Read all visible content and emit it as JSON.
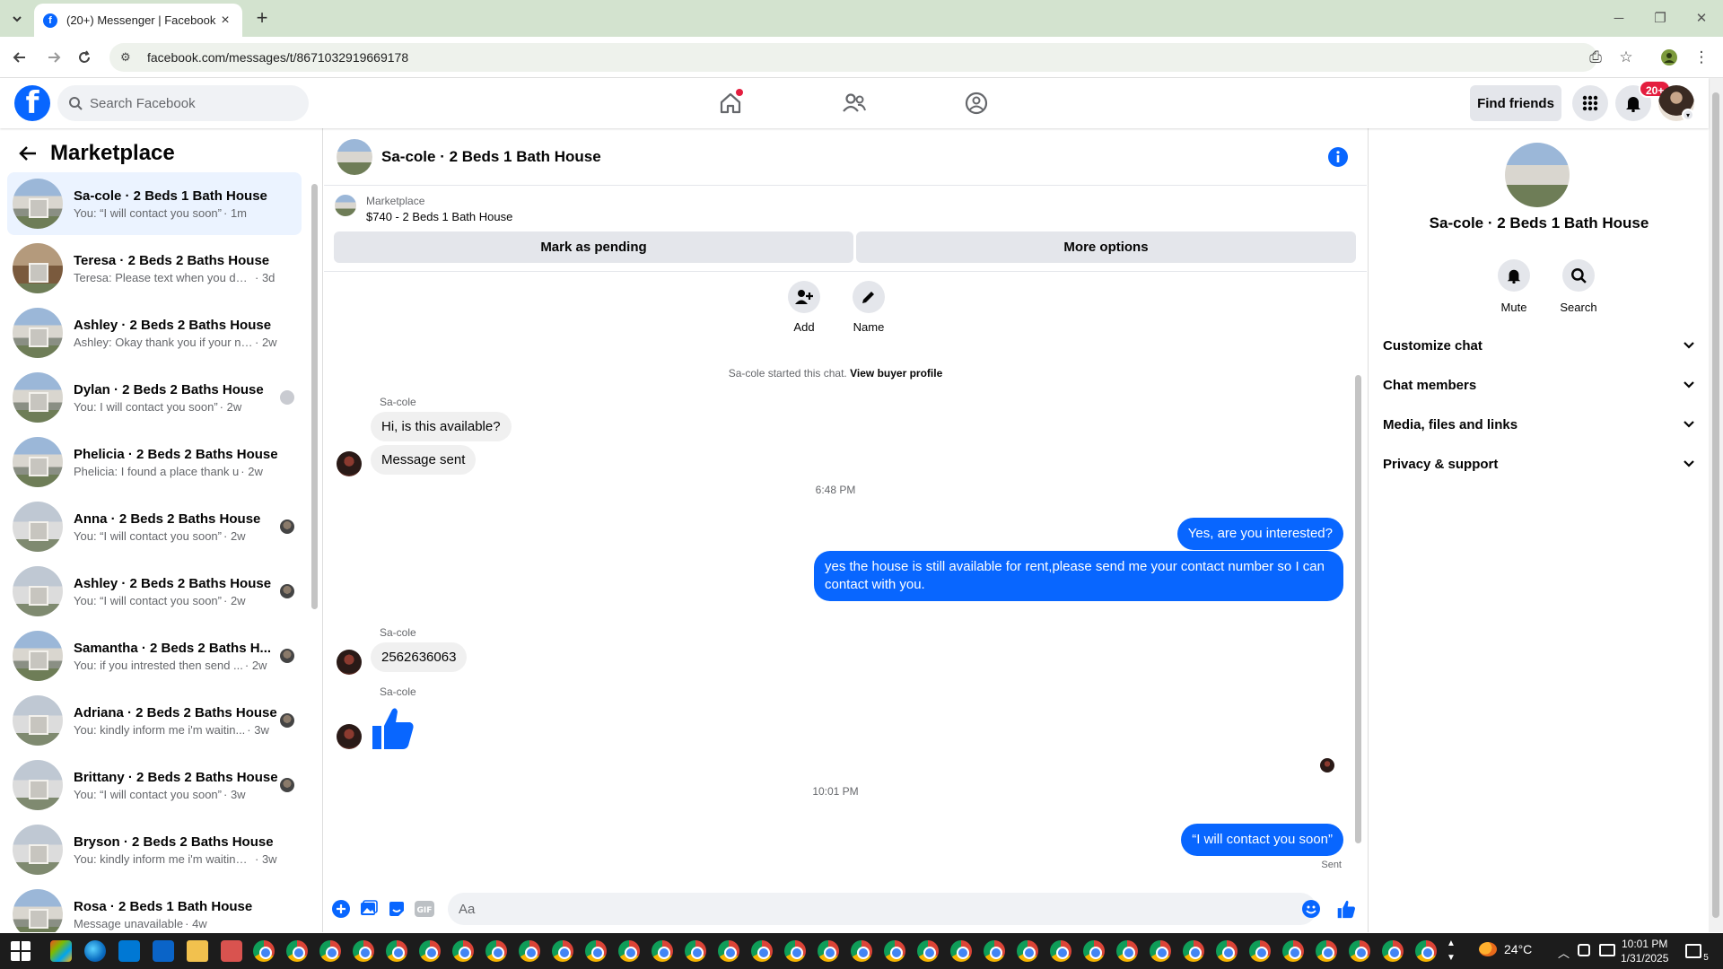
{
  "browser": {
    "tab_title": "(20+) Messenger | Facebook",
    "url": "facebook.com/messages/t/8671032919669178"
  },
  "fb_header": {
    "search_placeholder": "Search Facebook",
    "find_friends_label": "Find friends",
    "notification_count": "20+"
  },
  "sidebar": {
    "title": "Marketplace",
    "conversations": [
      {
        "name": "Sa-cole · 2 Beds 1 Bath House",
        "preview": "You: “I will contact you soon”",
        "time": "· 1m",
        "active": true
      },
      {
        "name": "Teresa · 2 Beds 2 Baths House",
        "preview": "Teresa: Please text when you do. T...",
        "time": "· 3d"
      },
      {
        "name": "Ashley · 2 Beds 2 Baths House",
        "preview": "Ashley: Okay thank you if your not...",
        "time": "· 2w"
      },
      {
        "name": "Dylan · 2 Beds 2 Baths House",
        "preview": "You: I will contact you soon”",
        "time": "· 2w"
      },
      {
        "name": "Phelicia · 2 Beds 2 Baths House",
        "preview": "Phelicia: I found a place thank u",
        "time": "· 2w"
      },
      {
        "name": "Anna · 2 Beds 2 Baths House",
        "preview": "You: “I will contact you soon”",
        "time": "· 2w"
      },
      {
        "name": "Ashley · 2 Beds 2 Baths House",
        "preview": "You: “I will contact you soon”",
        "time": "· 2w"
      },
      {
        "name": "Samantha · 2 Beds 2 Baths H...",
        "preview": "You: if you intrested then send ...",
        "time": "· 2w"
      },
      {
        "name": "Adriana · 2 Beds 2 Baths House",
        "preview": "You: kindly inform me i'm waitin...",
        "time": "· 3w"
      },
      {
        "name": "Brittany · 2 Beds 2 Baths House",
        "preview": "You: “I will contact you soon”",
        "time": "· 3w"
      },
      {
        "name": "Bryson · 2 Beds 2 Baths House",
        "preview": "You: kindly inform me i'm waiting f...",
        "time": "· 3w"
      },
      {
        "name": "Rosa · 2 Beds 1 Bath House",
        "preview": "Message unavailable",
        "time": "· 4w"
      }
    ]
  },
  "chat": {
    "title": "Sa-cole · 2 Beds 1 Bath House",
    "listing_source": "Marketplace",
    "listing_title": "$740 - 2 Beds 1 Bath House",
    "mark_pending_label": "Mark as pending",
    "more_options_label": "More options",
    "add_label": "Add",
    "name_label": "Name",
    "started_text": "Sa-cole started this chat.",
    "view_profile_label": "View buyer profile",
    "sender_name": "Sa-cole",
    "msg_1": "Hi, is this available?",
    "msg_2": "Message sent",
    "time_1": "6:48 PM",
    "msg_3": "Yes, are you interested?",
    "msg_4": "yes the house is still available for rent,please send me your contact number so I can contact with you.",
    "msg_5": "2562636063",
    "time_2": "10:01 PM",
    "msg_6": "“I will contact you soon”",
    "sent_label": "Sent",
    "input_placeholder": "Aa"
  },
  "right_panel": {
    "name": "Sa-cole · 2 Beds 1 Bath House",
    "mute_label": "Mute",
    "search_label": "Search",
    "sections": [
      "Customize chat",
      "Chat members",
      "Media, files and links",
      "Privacy & support"
    ]
  },
  "taskbar": {
    "weather": "24°C",
    "time": "10:01 PM",
    "date": "1/31/2025",
    "tray_count": "5"
  },
  "colors": {
    "fb_blue": "#0866ff",
    "bubble_in": "#f0f0f0",
    "active_conv": "#ebf3ff"
  }
}
